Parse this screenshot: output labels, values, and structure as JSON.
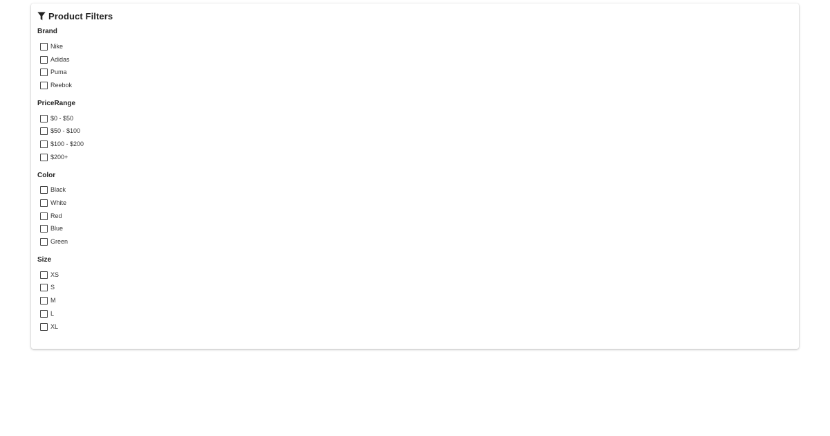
{
  "panel": {
    "title": "Product Filters",
    "icon": "filter-icon"
  },
  "sections": [
    {
      "title": "Brand",
      "options": [
        "Nike",
        "Adidas",
        "Puma",
        "Reebok"
      ]
    },
    {
      "title": "PriceRange",
      "options": [
        "$0 - $50",
        "$50 - $100",
        "$100 - $200",
        "$200+"
      ]
    },
    {
      "title": "Color",
      "options": [
        "Black",
        "White",
        "Red",
        "Blue",
        "Green"
      ]
    },
    {
      "title": "Size",
      "options": [
        "XS",
        "S",
        "M",
        "L",
        "XL"
      ]
    }
  ]
}
